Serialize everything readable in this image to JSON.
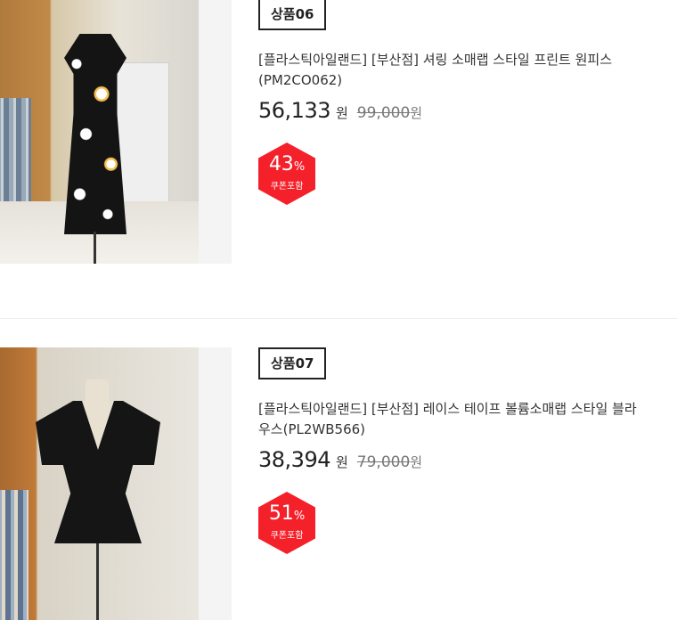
{
  "products": [
    {
      "label": "상품06",
      "title": "[플라스틱아일랜드] [부산점] 셔링 소매랩 스타일 프린트 원피스(PM2CO062)",
      "price": "56,133",
      "price_unit": "원",
      "original_price": "99,000",
      "original_unit": "원",
      "discount_value": "43",
      "discount_unit": "%",
      "discount_note": "쿠폰포함"
    },
    {
      "label": "상품07",
      "title": "[플라스틱아일랜드] [부산점] 레이스 테이프 볼륨소매랩 스타일 블라우스(PL2WB566)",
      "price": "38,394",
      "price_unit": "원",
      "original_price": "79,000",
      "original_unit": "원",
      "discount_value": "51",
      "discount_unit": "%",
      "discount_note": "쿠폰포함"
    }
  ],
  "colors": {
    "badge": "#f4202a",
    "divider": "#ececec"
  }
}
